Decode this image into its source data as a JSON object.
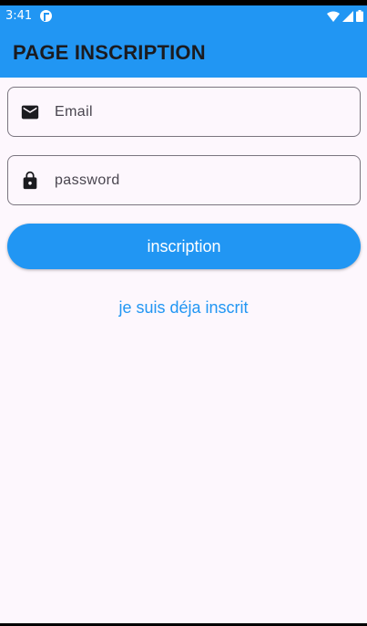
{
  "status_bar": {
    "time": "3:41"
  },
  "app_bar": {
    "title": "PAGE INSCRIPTION"
  },
  "form": {
    "email": {
      "placeholder": "Email",
      "icon": "mail-icon"
    },
    "password": {
      "placeholder": "password",
      "icon": "lock-icon"
    },
    "submit_label": "inscription",
    "login_link": "je suis déja inscrit"
  },
  "colors": {
    "primary": "#2196f3",
    "background": "#fdf7fd",
    "title_text": "#1b1b1f",
    "field_border": "#7a757f"
  }
}
